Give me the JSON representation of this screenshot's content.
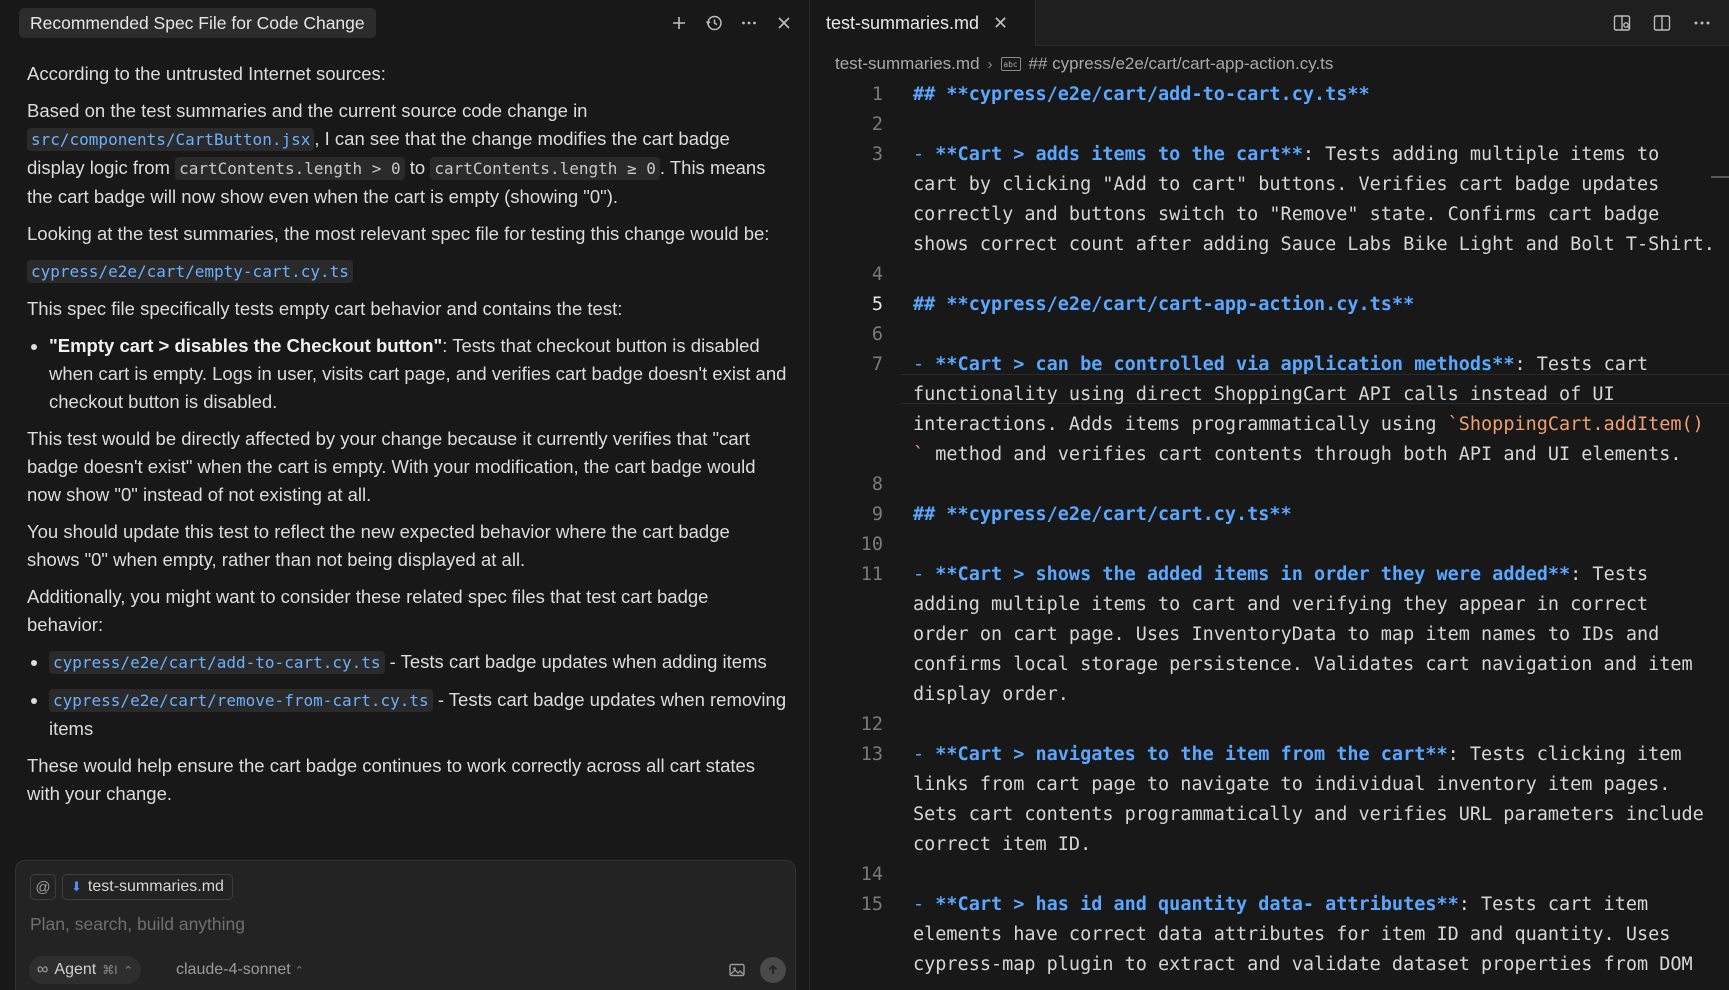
{
  "chat": {
    "title": "Recommended Spec File for Code Change",
    "paragraphs": {
      "p1": "According to the untrusted Internet sources:",
      "p2a": "Based on the test summaries and the current source code change in ",
      "p2_code1": "src/components/CartButton.jsx",
      "p2b": ", I can see that the change modifies the cart badge display logic from ",
      "p2_code2": "cartContents.length > 0",
      "p2c": " to ",
      "p2_code3": "cartContents.length ≥ 0",
      "p2d": ". This means the cart badge will now show even when the cart is empty (showing \"0\").",
      "p3": "Looking at the test summaries, the most relevant spec file for testing this change would be:",
      "spec_file": "cypress/e2e/cart/empty-cart.cy.ts",
      "p4": "This spec file specifically tests empty cart behavior and contains the test:",
      "bullet1_bold": "\"Empty cart > disables the Checkout button\"",
      "bullet1_rest": ": Tests that checkout button is disabled when cart is empty. Logs in user, visits cart page, and verifies cart badge doesn't exist and checkout button is disabled.",
      "p5": "This test would be directly affected by your change because it currently verifies that \"cart badge doesn't exist\" when the cart is empty. With your modification, the cart badge would now show \"0\" instead of not existing at all.",
      "p6": "You should update this test to reflect the new expected behavior where the cart badge shows \"0\" when empty, rather than not being displayed at all.",
      "p7": "Additionally, you might want to consider these related spec files that test cart badge behavior:",
      "related1_code": "cypress/e2e/cart/add-to-cart.cy.ts",
      "related1_text": " - Tests cart badge updates when adding items",
      "related2_code": "cypress/e2e/cart/remove-from-cart.cy.ts",
      "related2_text": " - Tests cart badge updates when removing items",
      "p8": "These would help ensure the cart badge continues to work correctly across all cart states with your change."
    },
    "composer": {
      "at_symbol": "@",
      "attached_file": "test-summaries.md",
      "placeholder": "Plan, search, build anything",
      "agent_label": "Agent",
      "agent_shortcut": "⌘I",
      "model": "claude-4-sonnet"
    }
  },
  "editor": {
    "tab_label": "test-summaries.md",
    "breadcrumb": {
      "file": "test-summaries.md",
      "symbol": "## cypress/e2e/cart/cart-app-action.cy.ts"
    },
    "active_line": "5",
    "line_numbers": [
      "1",
      "2",
      "3",
      "4",
      "5",
      "6",
      "7",
      "8",
      "9",
      "10",
      "11",
      "12",
      "13",
      "14",
      "15"
    ],
    "rows": {
      "r1": "## **cypress/e2e/cart/add-to-cart.cy.ts**",
      "r3a_dash": "- ",
      "r3a_bold": "**Cart > adds items to the cart**",
      "r3a_rest": ": Tests adding multiple items to",
      "r3b": "cart by clicking \"Add to cart\" buttons. Verifies cart badge updates",
      "r3c": "correctly and buttons switch to \"Remove\" state. Confirms cart badge",
      "r3d": "shows correct count after adding Sauce Labs Bike Light and Bolt T-Shirt.",
      "r5": "## **cypress/e2e/cart/cart-app-action.cy.ts**",
      "r7a_dash": "- ",
      "r7a_bold": "**Cart > can be controlled via application methods**",
      "r7a_rest": ": Tests cart",
      "r7b": "functionality using direct ShoppingCart API calls instead of UI",
      "r7c_text": "interactions. Adds items programmatically using ",
      "r7c_code": "`ShoppingCart.addItem()",
      "r7d_code": "`",
      "r7d_text": " method and verifies cart contents through both API and UI elements.",
      "r9": "## **cypress/e2e/cart/cart.cy.ts**",
      "r11a_dash": "- ",
      "r11a_bold": "**Cart > shows the added items in order they were added**",
      "r11a_rest": ": Tests",
      "r11b": "adding multiple items to cart and verifying they appear in correct",
      "r11c": "order on cart page. Uses InventoryData to map item names to IDs and",
      "r11d": "confirms local storage persistence. Validates cart navigation and item",
      "r11e": "display order.",
      "r13a_dash": "- ",
      "r13a_bold": "**Cart > navigates to the item from the cart**",
      "r13a_rest": ": Tests clicking item",
      "r13b": "links from cart page to navigate to individual inventory item pages.",
      "r13c": "Sets cart contents programmatically and verifies URL parameters include",
      "r13d": "correct item ID.",
      "r15a_dash": "- ",
      "r15a_bold": "**Cart > has id and quantity data- attributes**",
      "r15a_rest": ": Tests cart item",
      "r15b": "elements have correct data attributes for item ID and quantity. Uses",
      "r15c": "cypress-map plugin to extract and validate dataset properties from DOM"
    }
  },
  "colors": {
    "accent_blue": "#5aa7ff",
    "inline_code_orange": "#f0a06e",
    "background": "#181818"
  },
  "icons": {
    "chat_header": [
      "plus-icon",
      "history-icon",
      "more-icon",
      "close-icon"
    ],
    "editor_tools": [
      "open-preview-icon",
      "split-editor-icon",
      "more-icon"
    ]
  }
}
